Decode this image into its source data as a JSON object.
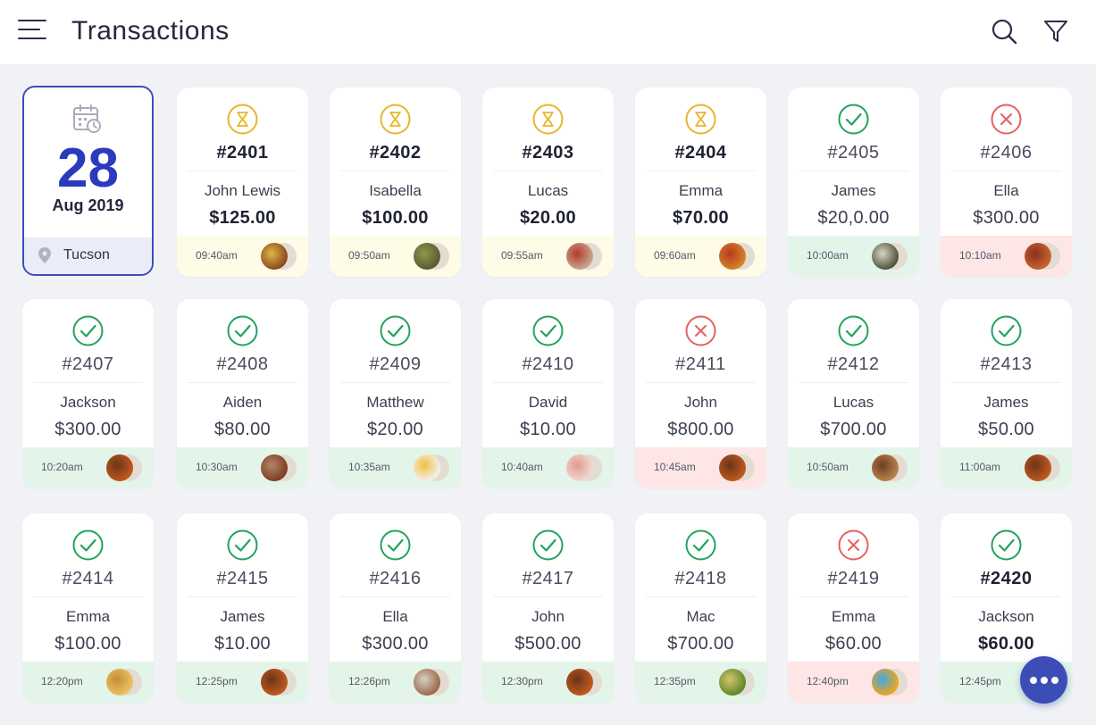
{
  "header": {
    "title": "Transactions",
    "icons": [
      "menu-icon",
      "search-icon",
      "filter-icon"
    ]
  },
  "date_card": {
    "day": "28",
    "month": "Aug 2019",
    "location": "Tucson"
  },
  "status_colors": {
    "pending": "#e8b52a",
    "completed": "#22a35c",
    "cancelled": "#e5605e"
  },
  "footer_colors": {
    "pending": "#fefbe6",
    "completed": "#e3f5e9",
    "cancelled": "#fde6e5"
  },
  "fab": {
    "icon": "more-icon"
  },
  "transactions": [
    {
      "number": "#2401",
      "customer": "John Lewis",
      "amount": "$125.00",
      "time": "09:40am",
      "status": "pending",
      "emphasis": true,
      "food": [
        "#8a4a1f",
        "#e2b544"
      ]
    },
    {
      "number": "#2402",
      "customer": "Isabella",
      "amount": "$100.00",
      "time": "09:50am",
      "status": "pending",
      "emphasis": true,
      "food": [
        "#5d5a34",
        "#8a9a4a"
      ]
    },
    {
      "number": "#2403",
      "customer": "Lucas",
      "amount": "$20.00",
      "time": "09:55am",
      "status": "pending",
      "emphasis": true,
      "food": [
        "#c9a58d",
        "#b33a2a"
      ]
    },
    {
      "number": "#2404",
      "customer": "Emma",
      "amount": "$70.00",
      "time": "09:60am",
      "status": "pending",
      "emphasis": true,
      "food": [
        "#d4822a",
        "#b83a1c"
      ]
    },
    {
      "number": "#2405",
      "customer": "James",
      "amount": "$20,0.00",
      "time": "10:00am",
      "status": "completed",
      "emphasis": false,
      "food": [
        "#50563a",
        "#d9d4c9"
      ]
    },
    {
      "number": "#2406",
      "customer": "Ella",
      "amount": "$300.00",
      "time": "10:10am",
      "status": "cancelled",
      "emphasis": false,
      "food": [
        "#c8642e",
        "#8a2f20"
      ]
    },
    {
      "number": "#2407",
      "customer": "Jackson",
      "amount": "$300.00",
      "time": "10:20am",
      "status": "completed",
      "emphasis": false,
      "food": [
        "#c0581f",
        "#6a3518"
      ]
    },
    {
      "number": "#2408",
      "customer": "Aiden",
      "amount": "$80.00",
      "time": "10:30am",
      "status": "completed",
      "emphasis": false,
      "food": [
        "#7c3f24",
        "#b48668"
      ]
    },
    {
      "number": "#2409",
      "customer": "Matthew",
      "amount": "$20.00",
      "time": "10:35am",
      "status": "completed",
      "emphasis": false,
      "food": [
        "#f3f0ea",
        "#f0c041"
      ]
    },
    {
      "number": "#2410",
      "customer": "David",
      "amount": "$10.00",
      "time": "10:40am",
      "status": "completed",
      "emphasis": false,
      "food": [
        "#f1d8d1",
        "#e09a90"
      ]
    },
    {
      "number": "#2411",
      "customer": "John",
      "amount": "$800.00",
      "time": "10:45am",
      "status": "cancelled",
      "emphasis": false,
      "food": [
        "#c0581f",
        "#6a3518"
      ]
    },
    {
      "number": "#2412",
      "customer": "Lucas",
      "amount": "$700.00",
      "time": "10:50am",
      "status": "completed",
      "emphasis": false,
      "food": [
        "#b8824e",
        "#6f3e22"
      ]
    },
    {
      "number": "#2413",
      "customer": "James",
      "amount": "$50.00",
      "time": "11:00am",
      "status": "completed",
      "emphasis": false,
      "food": [
        "#c0581f",
        "#6a3518"
      ]
    },
    {
      "number": "#2414",
      "customer": "Emma",
      "amount": "$100.00",
      "time": "12:20pm",
      "status": "completed",
      "emphasis": false,
      "food": [
        "#e8c26a",
        "#c68d2f"
      ]
    },
    {
      "number": "#2415",
      "customer": "James",
      "amount": "$10.00",
      "time": "12:25pm",
      "status": "completed",
      "emphasis": false,
      "food": [
        "#c0581f",
        "#6a3518"
      ]
    },
    {
      "number": "#2416",
      "customer": "Ella",
      "amount": "$300.00",
      "time": "12:26pm",
      "status": "completed",
      "emphasis": false,
      "food": [
        "#9a6a4a",
        "#d8cfc4"
      ]
    },
    {
      "number": "#2417",
      "customer": "John",
      "amount": "$500.00",
      "time": "12:30pm",
      "status": "completed",
      "emphasis": false,
      "food": [
        "#c0581f",
        "#6a3518"
      ]
    },
    {
      "number": "#2418",
      "customer": "Mac",
      "amount": "$700.00",
      "time": "12:35pm",
      "status": "completed",
      "emphasis": false,
      "food": [
        "#5e8a2c",
        "#d6c46a"
      ]
    },
    {
      "number": "#2419",
      "customer": "Emma",
      "amount": "$60.00",
      "time": "12:40pm",
      "status": "cancelled",
      "emphasis": false,
      "food": [
        "#f0a51e",
        "#3fa9e0"
      ]
    },
    {
      "number": "#2420",
      "customer": "Jackson",
      "amount": "$60.00",
      "time": "12:45pm",
      "status": "completed",
      "emphasis": true,
      "food": [
        "#c0581f",
        "#6a3518"
      ]
    }
  ]
}
